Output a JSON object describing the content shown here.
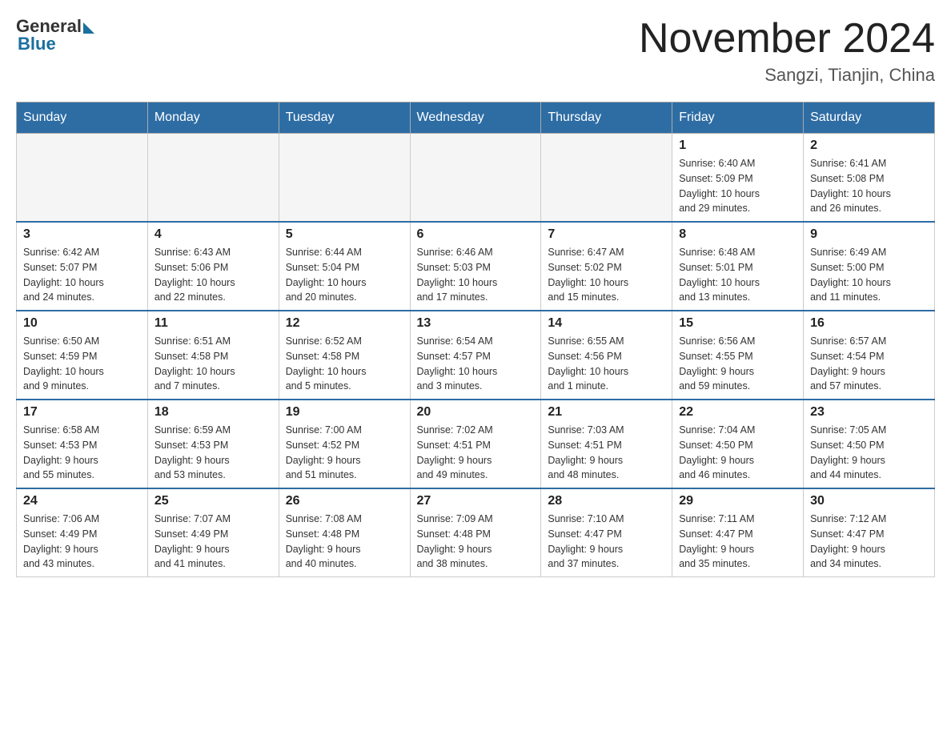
{
  "header": {
    "logo_general": "General",
    "logo_blue": "Blue",
    "month_title": "November 2024",
    "location": "Sangzi, Tianjin, China"
  },
  "days_of_week": [
    "Sunday",
    "Monday",
    "Tuesday",
    "Wednesday",
    "Thursday",
    "Friday",
    "Saturday"
  ],
  "weeks": [
    [
      {
        "day": "",
        "info": ""
      },
      {
        "day": "",
        "info": ""
      },
      {
        "day": "",
        "info": ""
      },
      {
        "day": "",
        "info": ""
      },
      {
        "day": "",
        "info": ""
      },
      {
        "day": "1",
        "info": "Sunrise: 6:40 AM\nSunset: 5:09 PM\nDaylight: 10 hours\nand 29 minutes."
      },
      {
        "day": "2",
        "info": "Sunrise: 6:41 AM\nSunset: 5:08 PM\nDaylight: 10 hours\nand 26 minutes."
      }
    ],
    [
      {
        "day": "3",
        "info": "Sunrise: 6:42 AM\nSunset: 5:07 PM\nDaylight: 10 hours\nand 24 minutes."
      },
      {
        "day": "4",
        "info": "Sunrise: 6:43 AM\nSunset: 5:06 PM\nDaylight: 10 hours\nand 22 minutes."
      },
      {
        "day": "5",
        "info": "Sunrise: 6:44 AM\nSunset: 5:04 PM\nDaylight: 10 hours\nand 20 minutes."
      },
      {
        "day": "6",
        "info": "Sunrise: 6:46 AM\nSunset: 5:03 PM\nDaylight: 10 hours\nand 17 minutes."
      },
      {
        "day": "7",
        "info": "Sunrise: 6:47 AM\nSunset: 5:02 PM\nDaylight: 10 hours\nand 15 minutes."
      },
      {
        "day": "8",
        "info": "Sunrise: 6:48 AM\nSunset: 5:01 PM\nDaylight: 10 hours\nand 13 minutes."
      },
      {
        "day": "9",
        "info": "Sunrise: 6:49 AM\nSunset: 5:00 PM\nDaylight: 10 hours\nand 11 minutes."
      }
    ],
    [
      {
        "day": "10",
        "info": "Sunrise: 6:50 AM\nSunset: 4:59 PM\nDaylight: 10 hours\nand 9 minutes."
      },
      {
        "day": "11",
        "info": "Sunrise: 6:51 AM\nSunset: 4:58 PM\nDaylight: 10 hours\nand 7 minutes."
      },
      {
        "day": "12",
        "info": "Sunrise: 6:52 AM\nSunset: 4:58 PM\nDaylight: 10 hours\nand 5 minutes."
      },
      {
        "day": "13",
        "info": "Sunrise: 6:54 AM\nSunset: 4:57 PM\nDaylight: 10 hours\nand 3 minutes."
      },
      {
        "day": "14",
        "info": "Sunrise: 6:55 AM\nSunset: 4:56 PM\nDaylight: 10 hours\nand 1 minute."
      },
      {
        "day": "15",
        "info": "Sunrise: 6:56 AM\nSunset: 4:55 PM\nDaylight: 9 hours\nand 59 minutes."
      },
      {
        "day": "16",
        "info": "Sunrise: 6:57 AM\nSunset: 4:54 PM\nDaylight: 9 hours\nand 57 minutes."
      }
    ],
    [
      {
        "day": "17",
        "info": "Sunrise: 6:58 AM\nSunset: 4:53 PM\nDaylight: 9 hours\nand 55 minutes."
      },
      {
        "day": "18",
        "info": "Sunrise: 6:59 AM\nSunset: 4:53 PM\nDaylight: 9 hours\nand 53 minutes."
      },
      {
        "day": "19",
        "info": "Sunrise: 7:00 AM\nSunset: 4:52 PM\nDaylight: 9 hours\nand 51 minutes."
      },
      {
        "day": "20",
        "info": "Sunrise: 7:02 AM\nSunset: 4:51 PM\nDaylight: 9 hours\nand 49 minutes."
      },
      {
        "day": "21",
        "info": "Sunrise: 7:03 AM\nSunset: 4:51 PM\nDaylight: 9 hours\nand 48 minutes."
      },
      {
        "day": "22",
        "info": "Sunrise: 7:04 AM\nSunset: 4:50 PM\nDaylight: 9 hours\nand 46 minutes."
      },
      {
        "day": "23",
        "info": "Sunrise: 7:05 AM\nSunset: 4:50 PM\nDaylight: 9 hours\nand 44 minutes."
      }
    ],
    [
      {
        "day": "24",
        "info": "Sunrise: 7:06 AM\nSunset: 4:49 PM\nDaylight: 9 hours\nand 43 minutes."
      },
      {
        "day": "25",
        "info": "Sunrise: 7:07 AM\nSunset: 4:49 PM\nDaylight: 9 hours\nand 41 minutes."
      },
      {
        "day": "26",
        "info": "Sunrise: 7:08 AM\nSunset: 4:48 PM\nDaylight: 9 hours\nand 40 minutes."
      },
      {
        "day": "27",
        "info": "Sunrise: 7:09 AM\nSunset: 4:48 PM\nDaylight: 9 hours\nand 38 minutes."
      },
      {
        "day": "28",
        "info": "Sunrise: 7:10 AM\nSunset: 4:47 PM\nDaylight: 9 hours\nand 37 minutes."
      },
      {
        "day": "29",
        "info": "Sunrise: 7:11 AM\nSunset: 4:47 PM\nDaylight: 9 hours\nand 35 minutes."
      },
      {
        "day": "30",
        "info": "Sunrise: 7:12 AM\nSunset: 4:47 PM\nDaylight: 9 hours\nand 34 minutes."
      }
    ]
  ]
}
